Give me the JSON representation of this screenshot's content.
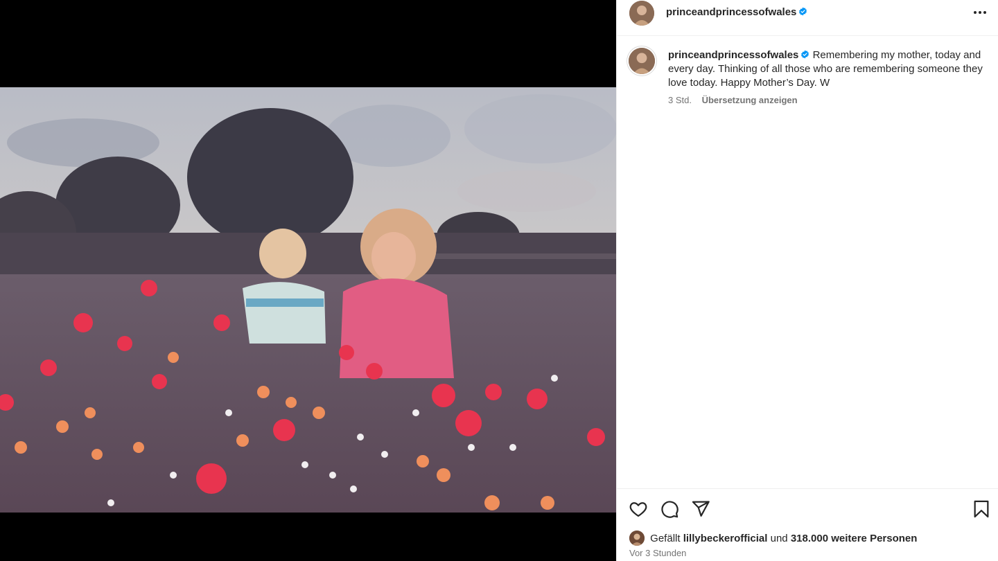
{
  "post": {
    "image_alt": "Vintage photo of a woman and small child in a field of wildflowers"
  },
  "header": {
    "username": "princeandprincessofwales",
    "avatar_icon": "profile-avatar",
    "verified_icon": "verified-badge-icon",
    "more_icon": "more-options-icon"
  },
  "caption": {
    "username": "princeandprincessofwales",
    "text": "Remembering my mother, today and every day. Thinking of all those who are remembering someone they love today. Happy Mother’s Day. W",
    "time": "3 Std.",
    "translate_label": "Übersetzung anzeigen"
  },
  "actions": {
    "like_icon": "heart-icon",
    "comment_icon": "comment-icon",
    "share_icon": "share-icon",
    "save_icon": "bookmark-icon"
  },
  "likes": {
    "prefix": "Gefällt",
    "user": "lillybeckerofficial",
    "connector": "und",
    "count_text": "318.000 weitere Personen"
  },
  "posted": "Vor 3 Stunden",
  "colors": {
    "verified_blue": "#0095f6",
    "text_primary": "#262626",
    "text_secondary": "#737373",
    "divider": "#efefef"
  }
}
